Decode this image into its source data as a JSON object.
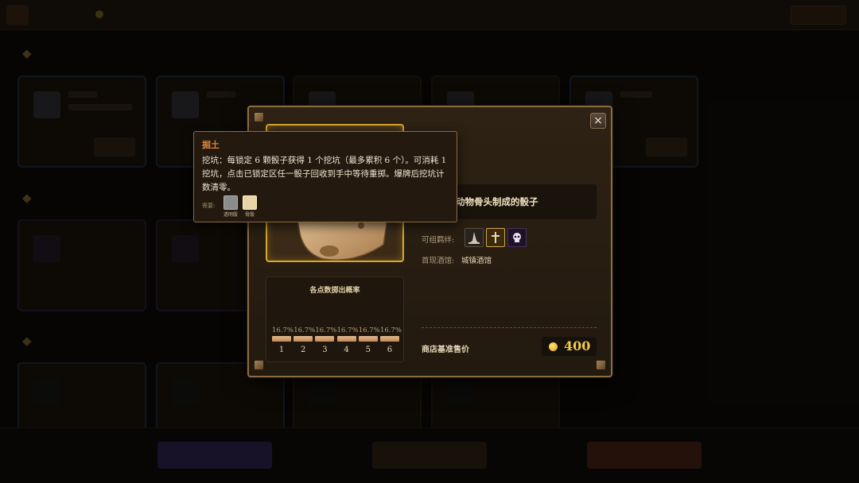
{
  "tooltip": {
    "title": "掘土",
    "description": "挖坑：每锁定 6 颗骰子获得 1 个挖坑（最多累积 6 个）。可消耗 1 挖坑，点击已锁定区任一骰子回收到手中等待重掷。爆牌后挖坑计数清零。",
    "requires_label": "需要:",
    "requires": [
      {
        "name": "透明骰",
        "icon": "transparent-die-icon",
        "color": "#8c8c8c"
      },
      {
        "name": "骨骰",
        "icon": "bone-die-icon",
        "color": "#e8d4a6"
      }
    ]
  },
  "modal": {
    "close_symbol": "×",
    "description": "动物骨头制成的骰子",
    "combo_label": "可组羁绊:",
    "combo_icons": [
      "witch-hat-icon",
      "holy-cross-icon",
      "skull-icon"
    ],
    "tavern_label": "首现酒馆:",
    "tavern_value": "城镇酒馆",
    "price_label": "商店基准售价",
    "price_value": "400",
    "probability": {
      "title": "各点数掷出概率",
      "faces": [
        {
          "face": "1",
          "pct": "16.7%"
        },
        {
          "face": "2",
          "pct": "16.7%"
        },
        {
          "face": "3",
          "pct": "16.7%"
        },
        {
          "face": "4",
          "pct": "16.7%"
        },
        {
          "face": "5",
          "pct": "16.7%"
        },
        {
          "face": "6",
          "pct": "16.7%"
        }
      ]
    }
  },
  "colors": {
    "accent_gold": "#d9a82e",
    "coin": "#f2c94a",
    "tooltip_title": "#d8883e",
    "frame": "#8b6c40"
  }
}
